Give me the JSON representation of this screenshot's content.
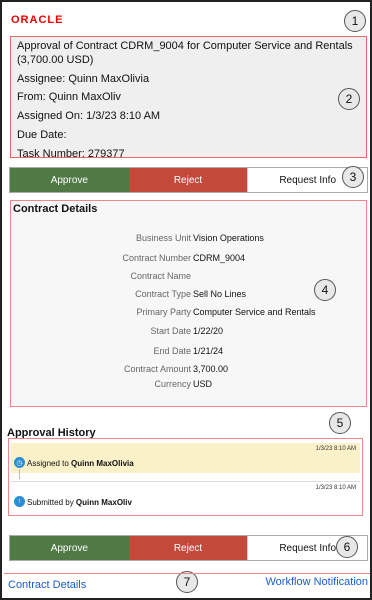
{
  "brand": {
    "logo_text": "ORACLE"
  },
  "callouts": [
    "1",
    "2",
    "3",
    "4",
    "5",
    "6",
    "7"
  ],
  "summary": {
    "title": "Approval of  Contract CDRM_9004 for Computer Service and Rentals (3,700.00 USD)",
    "assignee": "Assignee: Quinn MaxOlivia",
    "from": "From: Quinn MaxOliv",
    "assigned_on": "Assigned On: 1/3/23 8:10 AM",
    "due_date": "Due Date:",
    "task_number": "Task Number: 279377"
  },
  "actions": {
    "approve": "Approve",
    "reject": "Reject",
    "request_info": "Request Info"
  },
  "contract_details": {
    "title": "Contract Details",
    "fields": [
      {
        "label": "Business Unit",
        "value": "Vision Operations"
      },
      {
        "label": "Contract Number",
        "value": "CDRM_9004"
      },
      {
        "label": "Contract Name",
        "value": ""
      },
      {
        "label": "Contract Type",
        "value": "Sell No Lines"
      },
      {
        "label": "Primary Party",
        "value": "Computer Service and Rentals"
      },
      {
        "label": "Start Date",
        "value": "1/22/20"
      },
      {
        "label": "End Date",
        "value": "1/21/24"
      },
      {
        "label": "Contract Amount",
        "value": "3,700.00"
      },
      {
        "label": "Currency",
        "value": "USD"
      }
    ]
  },
  "approval_history": {
    "title": "Approval History",
    "items": [
      {
        "time": "1/3/23 8:10 AM",
        "prefix": "Assigned to ",
        "name": "Quinn MaxOlivia"
      },
      {
        "time": "1/3/23 8:10 AM",
        "prefix": "Submitted by ",
        "name": "Quinn MaxOliv"
      }
    ]
  },
  "footer": {
    "left_link": "Contract Details",
    "right_link": "Workflow Notification"
  },
  "colors": {
    "approve": "#4f7a45",
    "reject": "#c34a3b",
    "link": "#1b5bd2",
    "highlight": "#fbf1c9",
    "brand": "#e00000"
  }
}
